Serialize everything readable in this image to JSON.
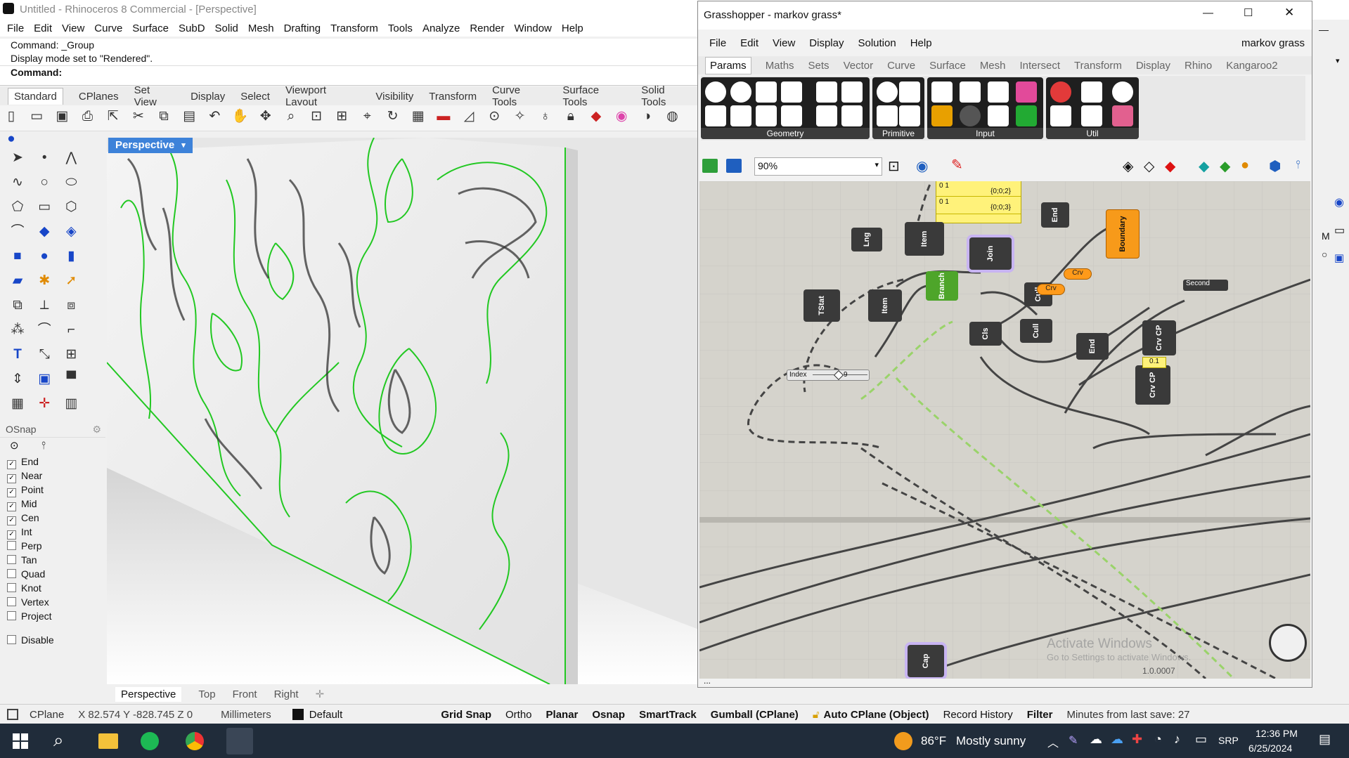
{
  "rhino": {
    "title": "Untitled - Rhinoceros 8 Commercial - [Perspective]",
    "menu": [
      "File",
      "Edit",
      "View",
      "Curve",
      "Surface",
      "SubD",
      "Solid",
      "Mesh",
      "Drafting",
      "Transform",
      "Tools",
      "Analyze",
      "Render",
      "Window",
      "Help"
    ],
    "command_history": [
      "Command: _Group",
      "Display mode set to \"Rendered\"."
    ],
    "command_prompt": "Command:",
    "toolbar_tabs": [
      "Standard",
      "CPlanes",
      "Set View",
      "Display",
      "Select",
      "Viewport Layout",
      "Visibility",
      "Transform",
      "Curve Tools",
      "Surface Tools",
      "Solid Tools"
    ],
    "viewport_label": "Perspective",
    "viewport_tabs": [
      "Perspective",
      "Top",
      "Front",
      "Right"
    ],
    "osnap": {
      "title": "OSnap",
      "items": [
        {
          "label": "End",
          "checked": true
        },
        {
          "label": "Near",
          "checked": true
        },
        {
          "label": "Point",
          "checked": true
        },
        {
          "label": "Mid",
          "checked": true
        },
        {
          "label": "Cen",
          "checked": true
        },
        {
          "label": "Int",
          "checked": true
        },
        {
          "label": "Perp",
          "checked": false
        },
        {
          "label": "Tan",
          "checked": false
        },
        {
          "label": "Quad",
          "checked": false
        },
        {
          "label": "Knot",
          "checked": false
        },
        {
          "label": "Vertex",
          "checked": false
        },
        {
          "label": "Project",
          "checked": false
        }
      ],
      "disable": "Disable"
    },
    "status": {
      "cplane": "CPlane",
      "coords": "X 82.574 Y -828.745 Z 0",
      "units": "Millimeters",
      "layer": "Default",
      "grid_snap": "Grid Snap",
      "ortho": "Ortho",
      "planar": "Planar",
      "osnap": "Osnap",
      "smarttrack": "SmartTrack",
      "gumball": "Gumball (CPlane)",
      "auto_cplane": "Auto CPlane (Object)",
      "record_history": "Record History",
      "filter": "Filter",
      "save_info": "Minutes from last save: 27"
    },
    "curve_color": "#22c822"
  },
  "grasshopper": {
    "title": "Grasshopper - markov grass*",
    "document_name": "markov grass",
    "menu": [
      "File",
      "Edit",
      "View",
      "Display",
      "Solution",
      "Help"
    ],
    "tabs": [
      "Params",
      "Maths",
      "Sets",
      "Vector",
      "Curve",
      "Surface",
      "Mesh",
      "Intersect",
      "Transform",
      "Display",
      "Rhino",
      "Kangaroo2"
    ],
    "groups": [
      "Geometry",
      "Primitive",
      "Input",
      "Util"
    ],
    "zoom": "90%",
    "panel_values": [
      "{0;0;2}",
      "{0;0;3}"
    ],
    "panel_indices": [
      "0 1",
      "0 1"
    ],
    "nodes": [
      "End",
      "Boundary",
      "Lng",
      "Item",
      "Join",
      "Branch",
      "TStat",
      "Item",
      "Cull",
      "Cls",
      "Cull",
      "End",
      "Crv CP",
      "Crv CP",
      "Cap"
    ],
    "params": [
      "Crv",
      "Crv"
    ],
    "slider_label": "Index",
    "slider_value": "9",
    "yellow_param": "0.1",
    "second_label": "Second",
    "watermark_line1": "Activate Windows",
    "watermark_line2": "Go to Settings to activate Windows.",
    "version": "1.0.0007",
    "status_text": "..."
  },
  "taskbar": {
    "weather_temp": "86°F",
    "weather_text": "Mostly sunny",
    "language": "SRP",
    "time": "12:36 PM",
    "date": "6/25/2024"
  }
}
